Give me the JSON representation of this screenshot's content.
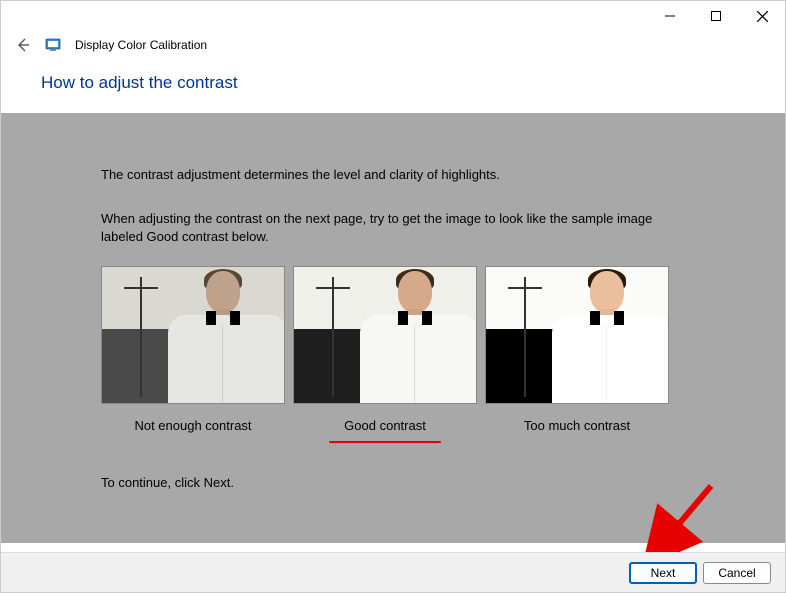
{
  "window": {
    "app_title": "Display Color Calibration"
  },
  "heading": "How to adjust the contrast",
  "content": {
    "intro1": "The contrast adjustment determines the level and clarity of highlights.",
    "intro2": "When adjusting the contrast on the next page, try to get the image to look like the sample image labeled Good contrast below.",
    "samples": [
      {
        "caption": "Not enough contrast"
      },
      {
        "caption": "Good contrast"
      },
      {
        "caption": "Too much contrast"
      }
    ],
    "continue_line": "To continue, click Next."
  },
  "footer": {
    "next_label": "Next",
    "cancel_label": "Cancel"
  }
}
